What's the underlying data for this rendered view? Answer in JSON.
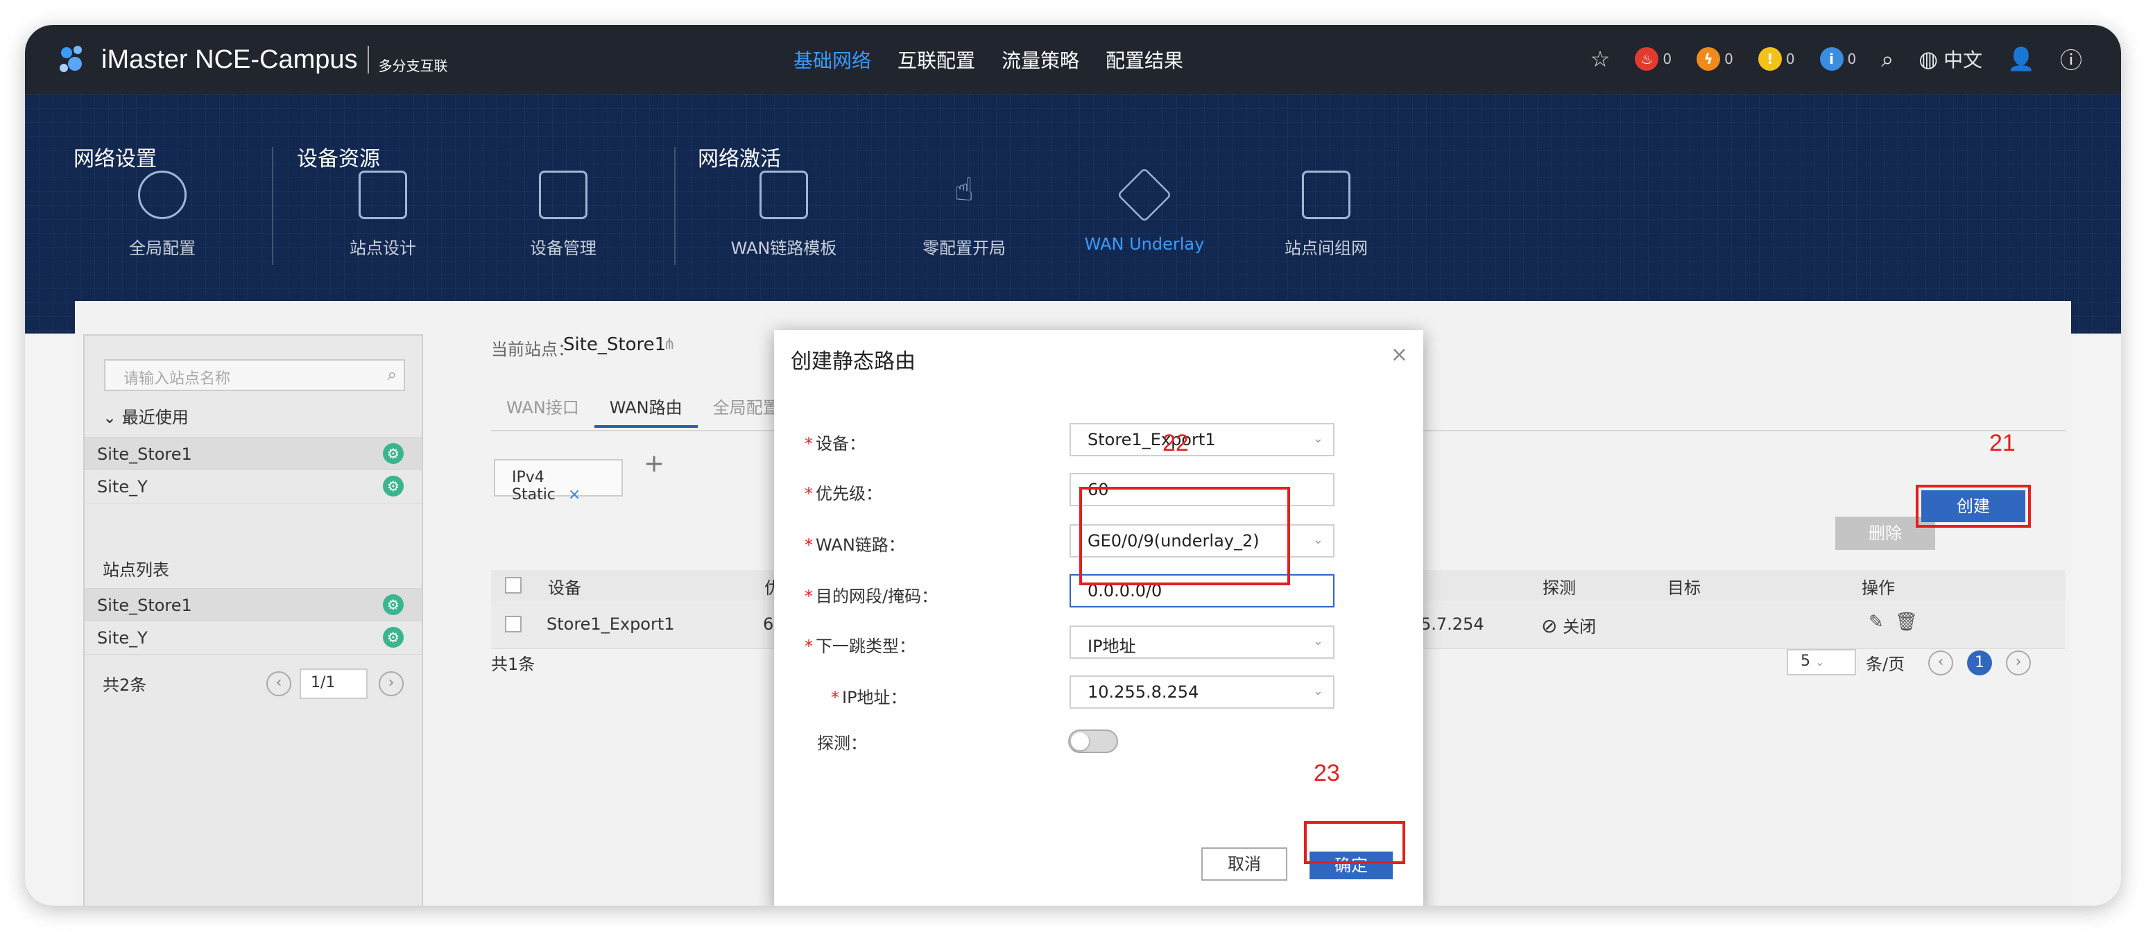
{
  "app": {
    "brand": "iMaster NCE-Campus",
    "subtitle": "多分支互联",
    "main_nav": [
      "基础网络",
      "互联配置",
      "流量策略",
      "配置结果"
    ],
    "active_nav": "基础网络",
    "alarms": [
      {
        "icon": "critical-alarm-icon",
        "count": "0",
        "color": "#e23b2e"
      },
      {
        "icon": "major-alarm-icon",
        "count": "0",
        "color": "#f08a1c"
      },
      {
        "icon": "minor-alarm-icon",
        "count": "0",
        "color": "#f2c21b"
      },
      {
        "icon": "info-alarm-icon",
        "count": "0",
        "color": "#3a8de0"
      }
    ],
    "language": "中文"
  },
  "banner": {
    "groups": [
      "网络设置",
      "设备资源",
      "网络激活"
    ],
    "items": [
      "全局配置",
      "站点设计",
      "设备管理",
      "WAN链路模板",
      "零配置开局",
      "WAN Underlay",
      "站点间组网"
    ],
    "active_item": "WAN Underlay"
  },
  "left_panel": {
    "search_placeholder": "请输入站点名称",
    "recent_label": "最近使用",
    "recent_sites": [
      "Site_Store1",
      "Site_Y"
    ],
    "site_list_label": "站点列表",
    "sites": [
      "Site_Store1",
      "Site_Y"
    ],
    "total": "共2条",
    "page": "1/1"
  },
  "main": {
    "current_site_label": "当前站点：",
    "current_site": "Site_Store1",
    "tabs": [
      "WAN接口",
      "WAN路由",
      "全局配置"
    ],
    "active_tab": "WAN路由",
    "chip": "IPv4 Static",
    "delete_label": "删除",
    "create_label": "创建",
    "table_headers": [
      "设备",
      "优",
      "探测",
      "目标",
      "操作"
    ],
    "row": {
      "device": "Store1_Export1",
      "priority": "6",
      "nexthop_tail": "5.7.254",
      "probe": "关闭"
    },
    "total": "共1条",
    "page_size": "5",
    "page_size_unit": "条/页",
    "page_current": "1"
  },
  "annotations": [
    "21",
    "22",
    "23"
  ],
  "modal": {
    "title": "创建静态路由",
    "fields": [
      {
        "label": "设备：",
        "value": "Store1_Export1",
        "required": true
      },
      {
        "label": "优先级：",
        "value": "60",
        "required": true
      },
      {
        "label": "WAN链路：",
        "value": "GE0/0/9(underlay_2)",
        "required": true
      },
      {
        "label": "目的网段/掩码：",
        "value": "0.0.0.0/0",
        "required": true
      },
      {
        "label": "下一跳类型：",
        "value": "IP地址",
        "required": true
      },
      {
        "label": "IP地址：",
        "value": "10.255.8.254",
        "required": true
      },
      {
        "label": "探测：",
        "value": "",
        "required": false
      }
    ],
    "cancel_label": "取消",
    "ok_label": "确定"
  }
}
